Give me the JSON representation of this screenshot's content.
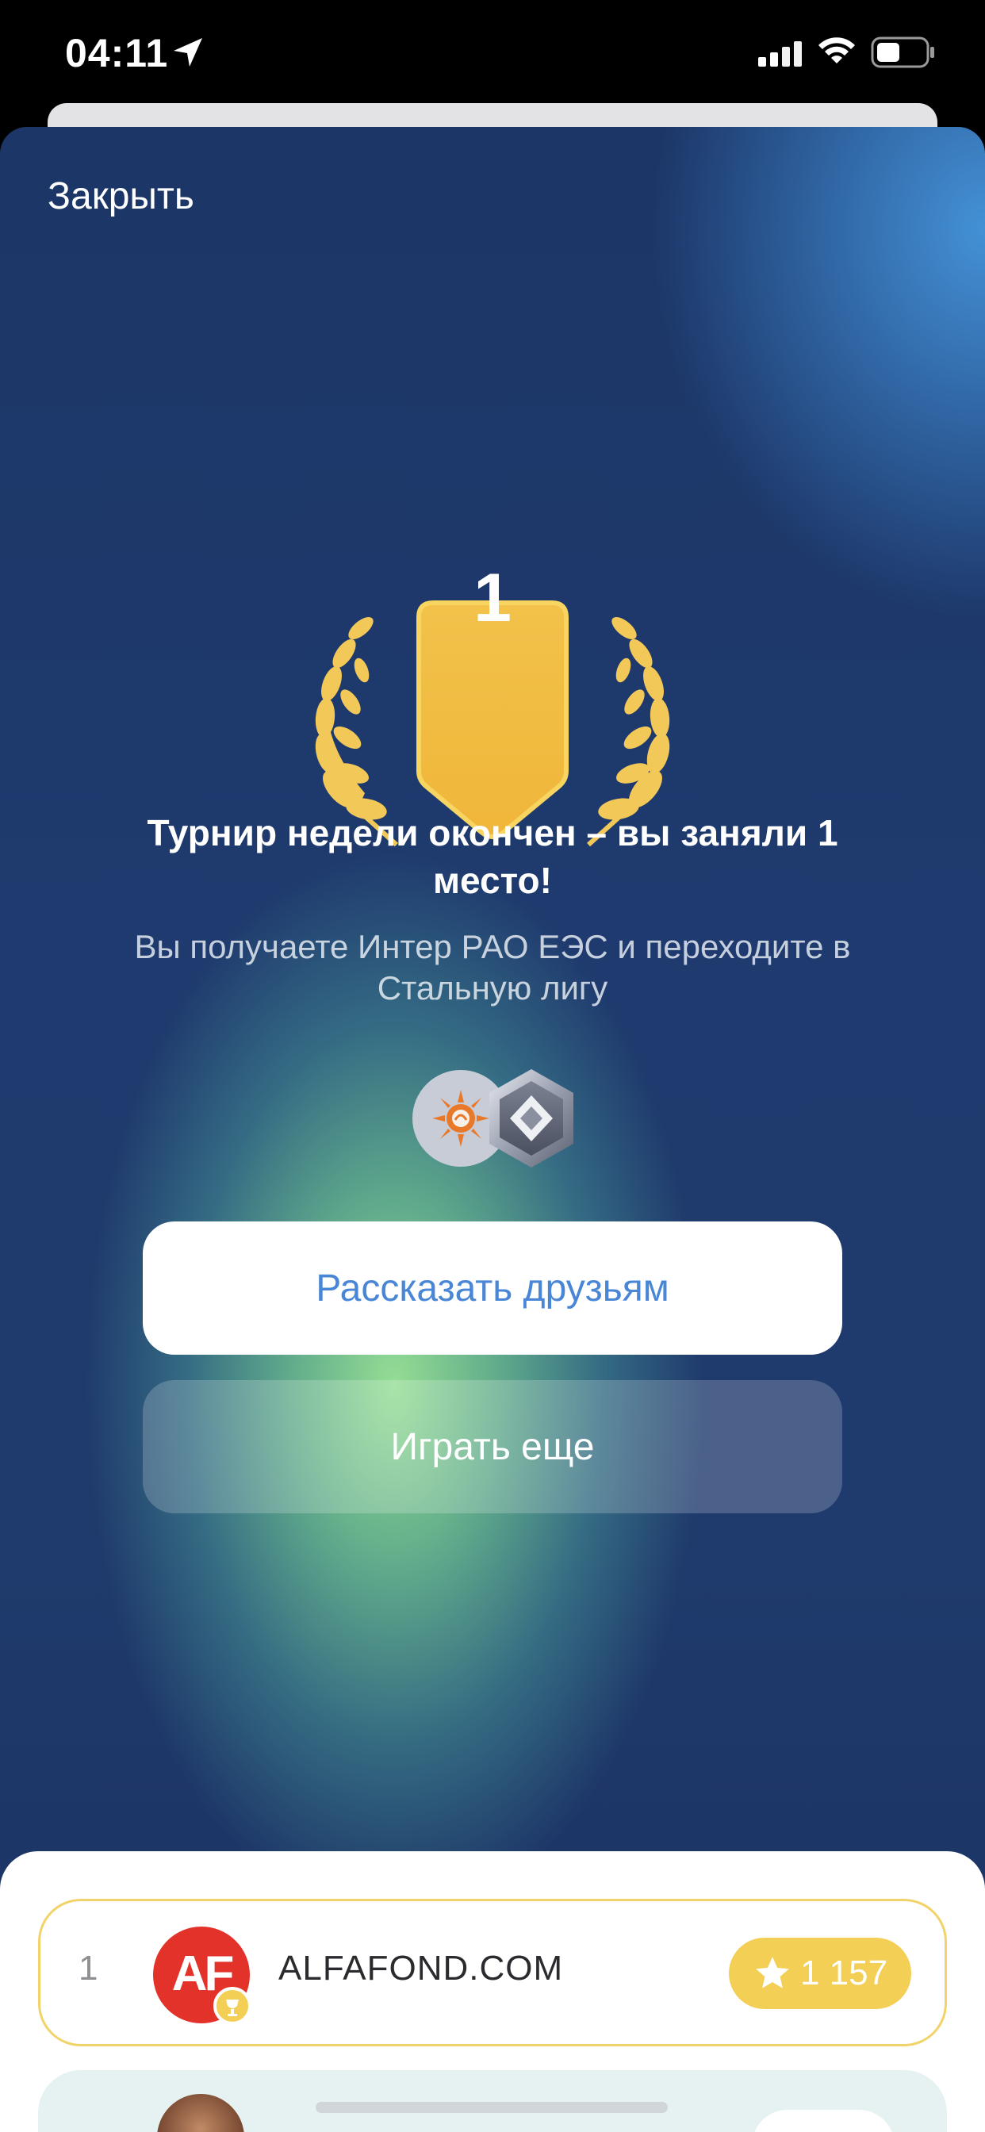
{
  "status_bar": {
    "time": "04:11",
    "icons": [
      "location-arrow-icon",
      "cellular-signal-icon",
      "wifi-icon",
      "battery-icon"
    ]
  },
  "modal": {
    "close_label": "Закрыть",
    "place_badge": "1",
    "title": "Турнир недели окончен – вы заняли 1 место!",
    "subtitle": "Вы получаете Интер РАО ЕЭС и переходите в Стальную лигу",
    "rewards": [
      "company-logo-icon",
      "steel-league-icon"
    ],
    "share_button": "Рассказать друзьям",
    "play_button": "Играть еще"
  },
  "leaderboard": {
    "rows": [
      {
        "rank": "1",
        "avatar_initials": "AF",
        "name": "ALFAFOND.COM",
        "score": "1 157"
      }
    ]
  },
  "colors": {
    "accent_blue": "#4a86d6",
    "gold": "#f3cf56",
    "background_dark": "#1f3a6e",
    "avatar_red": "#e2322a"
  }
}
